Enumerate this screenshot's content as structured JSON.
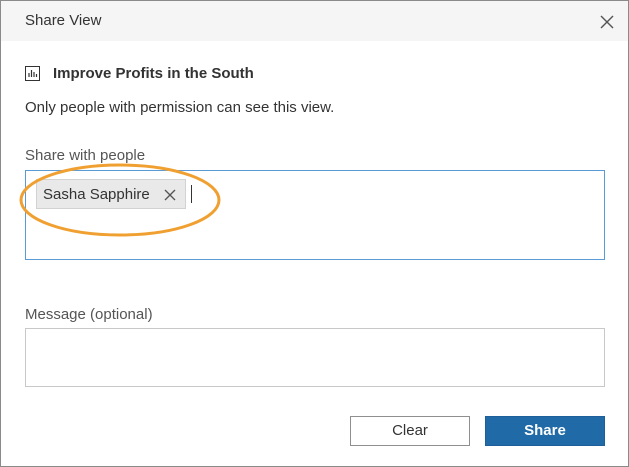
{
  "dialog": {
    "title": "Share View",
    "close_icon": "close-icon"
  },
  "view": {
    "icon": "bar-chart-icon",
    "name": "Improve Profits in the South"
  },
  "permission_note": "Only people with permission can see this view.",
  "share_with": {
    "label": "Share with people",
    "recipients": [
      {
        "name": "Sasha Sapphire",
        "remove_icon": "remove-x-icon"
      }
    ]
  },
  "message": {
    "label": "Message (optional)",
    "value": ""
  },
  "buttons": {
    "clear_label": "Clear",
    "share_label": "Share"
  },
  "colors": {
    "share_button": "#1f6aa7",
    "focus_border": "#5b9bd5",
    "highlight_ring": "#f0a030",
    "titlebar": "#f5f5f5"
  }
}
